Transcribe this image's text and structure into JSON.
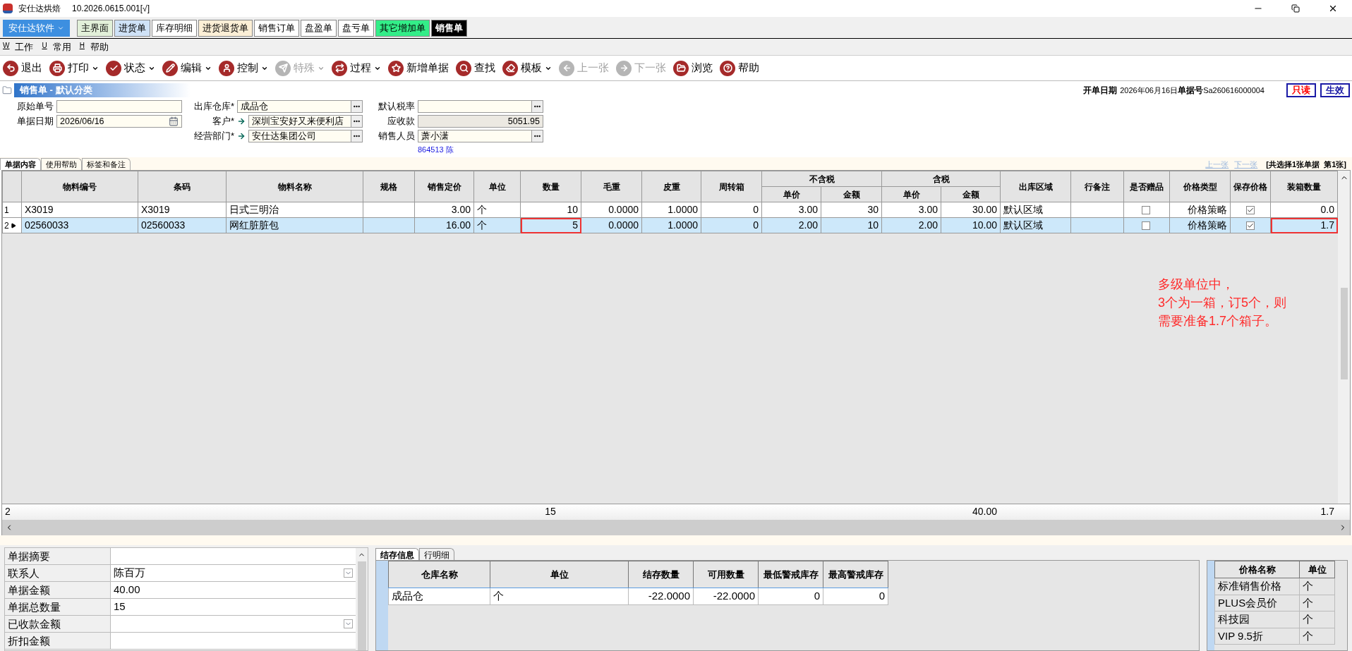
{
  "window": {
    "app_name": "安仕达烘焙",
    "version": "10.2026.0615.001[√]"
  },
  "brand_menu": {
    "label": "安仕达软件"
  },
  "doc_tabs": [
    {
      "label": "主界面",
      "color": "#e2f0d9",
      "selected": false
    },
    {
      "label": "进货单",
      "color": "#cfe2f7",
      "selected": false
    },
    {
      "label": "库存明细",
      "color": "#ffffff",
      "selected": false
    },
    {
      "label": "进货退货单",
      "color": "#fcefd6",
      "selected": false
    },
    {
      "label": "销售订单",
      "color": "#ffffff",
      "selected": false
    },
    {
      "label": "盘盈单",
      "color": "#ffffff",
      "selected": false
    },
    {
      "label": "盘亏单",
      "color": "#ffffff",
      "selected": false
    },
    {
      "label": "其它增加单",
      "color": "#33ee88",
      "selected": false
    },
    {
      "label": "销售单",
      "color": "#000000",
      "selected": true
    }
  ],
  "menu": [
    {
      "key": "W",
      "label": "工作"
    },
    {
      "key": "U",
      "label": "常用"
    },
    {
      "key": "H",
      "label": "帮助"
    }
  ],
  "toolbar": [
    {
      "label": "退出",
      "has_menu": false,
      "disabled": false
    },
    {
      "label": "打印",
      "has_menu": true,
      "disabled": false
    },
    {
      "label": "状态",
      "has_menu": true,
      "disabled": false
    },
    {
      "label": "编辑",
      "has_menu": true,
      "disabled": false
    },
    {
      "label": "控制",
      "has_menu": true,
      "disabled": false
    },
    {
      "label": "特殊",
      "has_menu": true,
      "disabled": true
    },
    {
      "label": "过程",
      "has_menu": true,
      "disabled": false
    },
    {
      "label": "新增单据",
      "has_menu": false,
      "disabled": false
    },
    {
      "label": "查找",
      "has_menu": false,
      "disabled": false
    },
    {
      "label": "模板",
      "has_menu": true,
      "disabled": false
    },
    {
      "label": "上一张",
      "has_menu": false,
      "disabled": true
    },
    {
      "label": "下一张",
      "has_menu": false,
      "disabled": true
    },
    {
      "label": "浏览",
      "has_menu": false,
      "disabled": false
    },
    {
      "label": "帮助",
      "has_menu": false,
      "disabled": false
    }
  ],
  "section": {
    "title": "销售单 - 默认分类",
    "open_date_label": "开单日期",
    "open_date": "2026年06月16日",
    "doc_no_label": "单据号",
    "doc_no": "Sa260616000004",
    "badges": [
      {
        "label": "只读",
        "color": "#ff0000"
      },
      {
        "label": "生效",
        "color": "#1a1aa6"
      }
    ]
  },
  "form_columns": [
    [
      {
        "label": "原始单号",
        "kind": "plain"
      },
      {
        "label": "单据日期",
        "value": "2026/06/16",
        "kind": "date"
      }
    ],
    [
      {
        "label": "出库仓库*",
        "value": "成品仓",
        "kind": "lookup"
      },
      {
        "label": "客户*",
        "value": "深圳宝安好又来便利店",
        "kind": "linked"
      },
      {
        "label": "经营部门*",
        "value": "安仕达集团公司",
        "kind": "linked"
      }
    ],
    [
      {
        "label": "默认税率",
        "kind": "lookup"
      },
      {
        "label": "应收款",
        "value": "5051.95",
        "kind": "readonly"
      },
      {
        "label": "销售人员",
        "value": "萧小潇",
        "kind": "lookup"
      }
    ]
  ],
  "form_note": "864513 陈",
  "content_tabs": [
    {
      "label": "单据内容",
      "selected": true
    },
    {
      "label": "使用帮助",
      "selected": false
    },
    {
      "label": "标签和备注",
      "selected": false
    }
  ],
  "pager": {
    "prev": "上一张",
    "next": "下一张",
    "info": "[共选择1张单据  第1张]"
  },
  "table": {
    "columns": [
      {
        "label": "物料编号"
      },
      {
        "label": "条码"
      },
      {
        "label": "物料名称"
      },
      {
        "label": "规格"
      },
      {
        "label": "销售定价"
      },
      {
        "label": "单位"
      },
      {
        "label": "数量"
      },
      {
        "label": "毛重"
      },
      {
        "label": "皮重"
      },
      {
        "label": "周转箱"
      },
      {
        "label": "不含税",
        "colspan": 2,
        "children": [
          {
            "label": "单价"
          },
          {
            "label": "金额"
          }
        ]
      },
      {
        "label": "含税",
        "colspan": 2,
        "children": [
          {
            "label": "单价"
          },
          {
            "label": "金额"
          }
        ]
      },
      {
        "label": "出库区域"
      },
      {
        "label": "行备注"
      },
      {
        "label": "是否赠品"
      },
      {
        "label": "价格类型"
      },
      {
        "label": "保存价格"
      },
      {
        "label": "装箱数量"
      }
    ],
    "rows": [
      {
        "number": "1",
        "selected": false,
        "cells": [
          {
            "kind": "left",
            "text": "X3019",
            "marked": false
          },
          {
            "kind": "left",
            "text": "X3019",
            "marked": false
          },
          {
            "kind": "left",
            "text": "日式三明治",
            "marked": false
          },
          {
            "kind": "left",
            "marked": false
          },
          {
            "kind": "right",
            "text": "3.00",
            "marked": false
          },
          {
            "kind": "left",
            "text": "个",
            "marked": false
          },
          {
            "kind": "right",
            "text": "10",
            "marked": false
          },
          {
            "kind": "right",
            "text": "0.0000",
            "marked": false
          },
          {
            "kind": "right",
            "text": "1.0000",
            "marked": false
          },
          {
            "kind": "right",
            "text": "0",
            "marked": false
          },
          {
            "kind": "right",
            "text": "3.00",
            "marked": false
          },
          {
            "kind": "right",
            "text": "30",
            "marked": false
          },
          {
            "kind": "right",
            "text": "3.00",
            "marked": false
          },
          {
            "kind": "right",
            "text": "30.00",
            "marked": false
          },
          {
            "kind": "left",
            "text": "默认区域",
            "marked": false
          },
          {
            "kind": "left",
            "marked": false
          },
          {
            "kind": "check",
            "checked": false,
            "marked": false
          },
          {
            "kind": "right",
            "text": "价格策略",
            "marked": false
          },
          {
            "kind": "check",
            "checked": true,
            "marked": false
          },
          {
            "kind": "right",
            "text": "0.0",
            "marked": false
          }
        ]
      },
      {
        "number": "2",
        "selected": true,
        "cells": [
          {
            "kind": "left",
            "text": "02560033",
            "marked": false
          },
          {
            "kind": "left",
            "text": "02560033",
            "marked": false
          },
          {
            "kind": "left",
            "text": "网红脏脏包",
            "marked": false
          },
          {
            "kind": "left",
            "marked": false
          },
          {
            "kind": "right",
            "text": "16.00",
            "marked": false
          },
          {
            "kind": "left",
            "text": "个",
            "marked": false
          },
          {
            "kind": "right",
            "text": "5",
            "marked": true
          },
          {
            "kind": "right",
            "text": "0.0000",
            "marked": false
          },
          {
            "kind": "right",
            "text": "1.0000",
            "marked": false
          },
          {
            "kind": "right",
            "text": "0",
            "marked": false
          },
          {
            "kind": "right",
            "text": "2.00",
            "marked": false
          },
          {
            "kind": "right",
            "text": "10",
            "marked": false
          },
          {
            "kind": "right",
            "text": "2.00",
            "marked": false
          },
          {
            "kind": "right",
            "text": "10.00",
            "marked": false
          },
          {
            "kind": "left",
            "text": "默认区域",
            "marked": false
          },
          {
            "kind": "left",
            "marked": false
          },
          {
            "kind": "check",
            "checked": false,
            "marked": false
          },
          {
            "kind": "right",
            "text": "价格策略",
            "marked": false
          },
          {
            "kind": "check",
            "checked": true,
            "marked": false
          },
          {
            "kind": "right",
            "text": "1.7",
            "marked": true
          }
        ]
      }
    ],
    "footer": {
      "count": "2",
      "cells": [
        {},
        {},
        {},
        {},
        {},
        {},
        {
          "text": "15"
        },
        {},
        {},
        {},
        {},
        {},
        {},
        {
          "text": "40.00"
        },
        {},
        {},
        {},
        {},
        {},
        {
          "text": "1.7"
        }
      ]
    }
  },
  "annotation": [
    "多级单位中，",
    "3个为一箱，订5个，则",
    "需要准备1.7个箱子。"
  ],
  "summary": [
    {
      "label": "单据摘要",
      "kind": "plain"
    },
    {
      "label": "联系人",
      "value": "陈百万",
      "kind": "dropdown"
    },
    {
      "label": "单据金额",
      "value": "40.00",
      "kind": "plain"
    },
    {
      "label": "单据总数量",
      "value": "15",
      "kind": "plain"
    },
    {
      "label": "已收款金额",
      "kind": "dropdown"
    },
    {
      "label": "折扣金额",
      "kind": "plain"
    }
  ],
  "stock_tabs": [
    {
      "label": "结存信息",
      "selected": true
    },
    {
      "label": "行明细",
      "selected": false
    }
  ],
  "stock_table": {
    "columns": [
      "仓库名称",
      "单位",
      "结存数量",
      "可用数量",
      "最低警戒库存",
      "最高警戒库存"
    ],
    "rows": [
      [
        "成品仓",
        "个",
        "-22.0000",
        "-22.0000",
        "0",
        "0"
      ]
    ]
  },
  "price_table": {
    "columns": [
      "价格名称",
      "单位"
    ],
    "rows": [
      [
        "标准销售价格",
        "个"
      ],
      [
        "PLUS会员价",
        "个"
      ],
      [
        "科技园",
        "个"
      ],
      [
        "VIP 9.5折",
        "个"
      ]
    ]
  }
}
